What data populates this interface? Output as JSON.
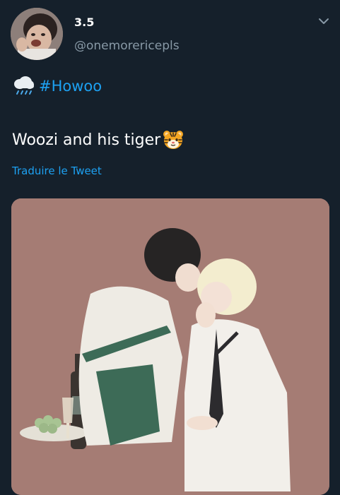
{
  "author": {
    "display_name": "3.5",
    "handle": "@onemorericepls"
  },
  "tweet": {
    "hashtag": "#Howoo",
    "text": "Woozi and his tiger",
    "translate_label": "Traduire le Tweet"
  },
  "icons": {
    "weather": "rain-cloud-icon",
    "emoji": "tiger-face-icon",
    "menu": "chevron-down-icon"
  },
  "colors": {
    "background": "#15202b",
    "link": "#1da1f2",
    "secondary_text": "#8899a6"
  }
}
